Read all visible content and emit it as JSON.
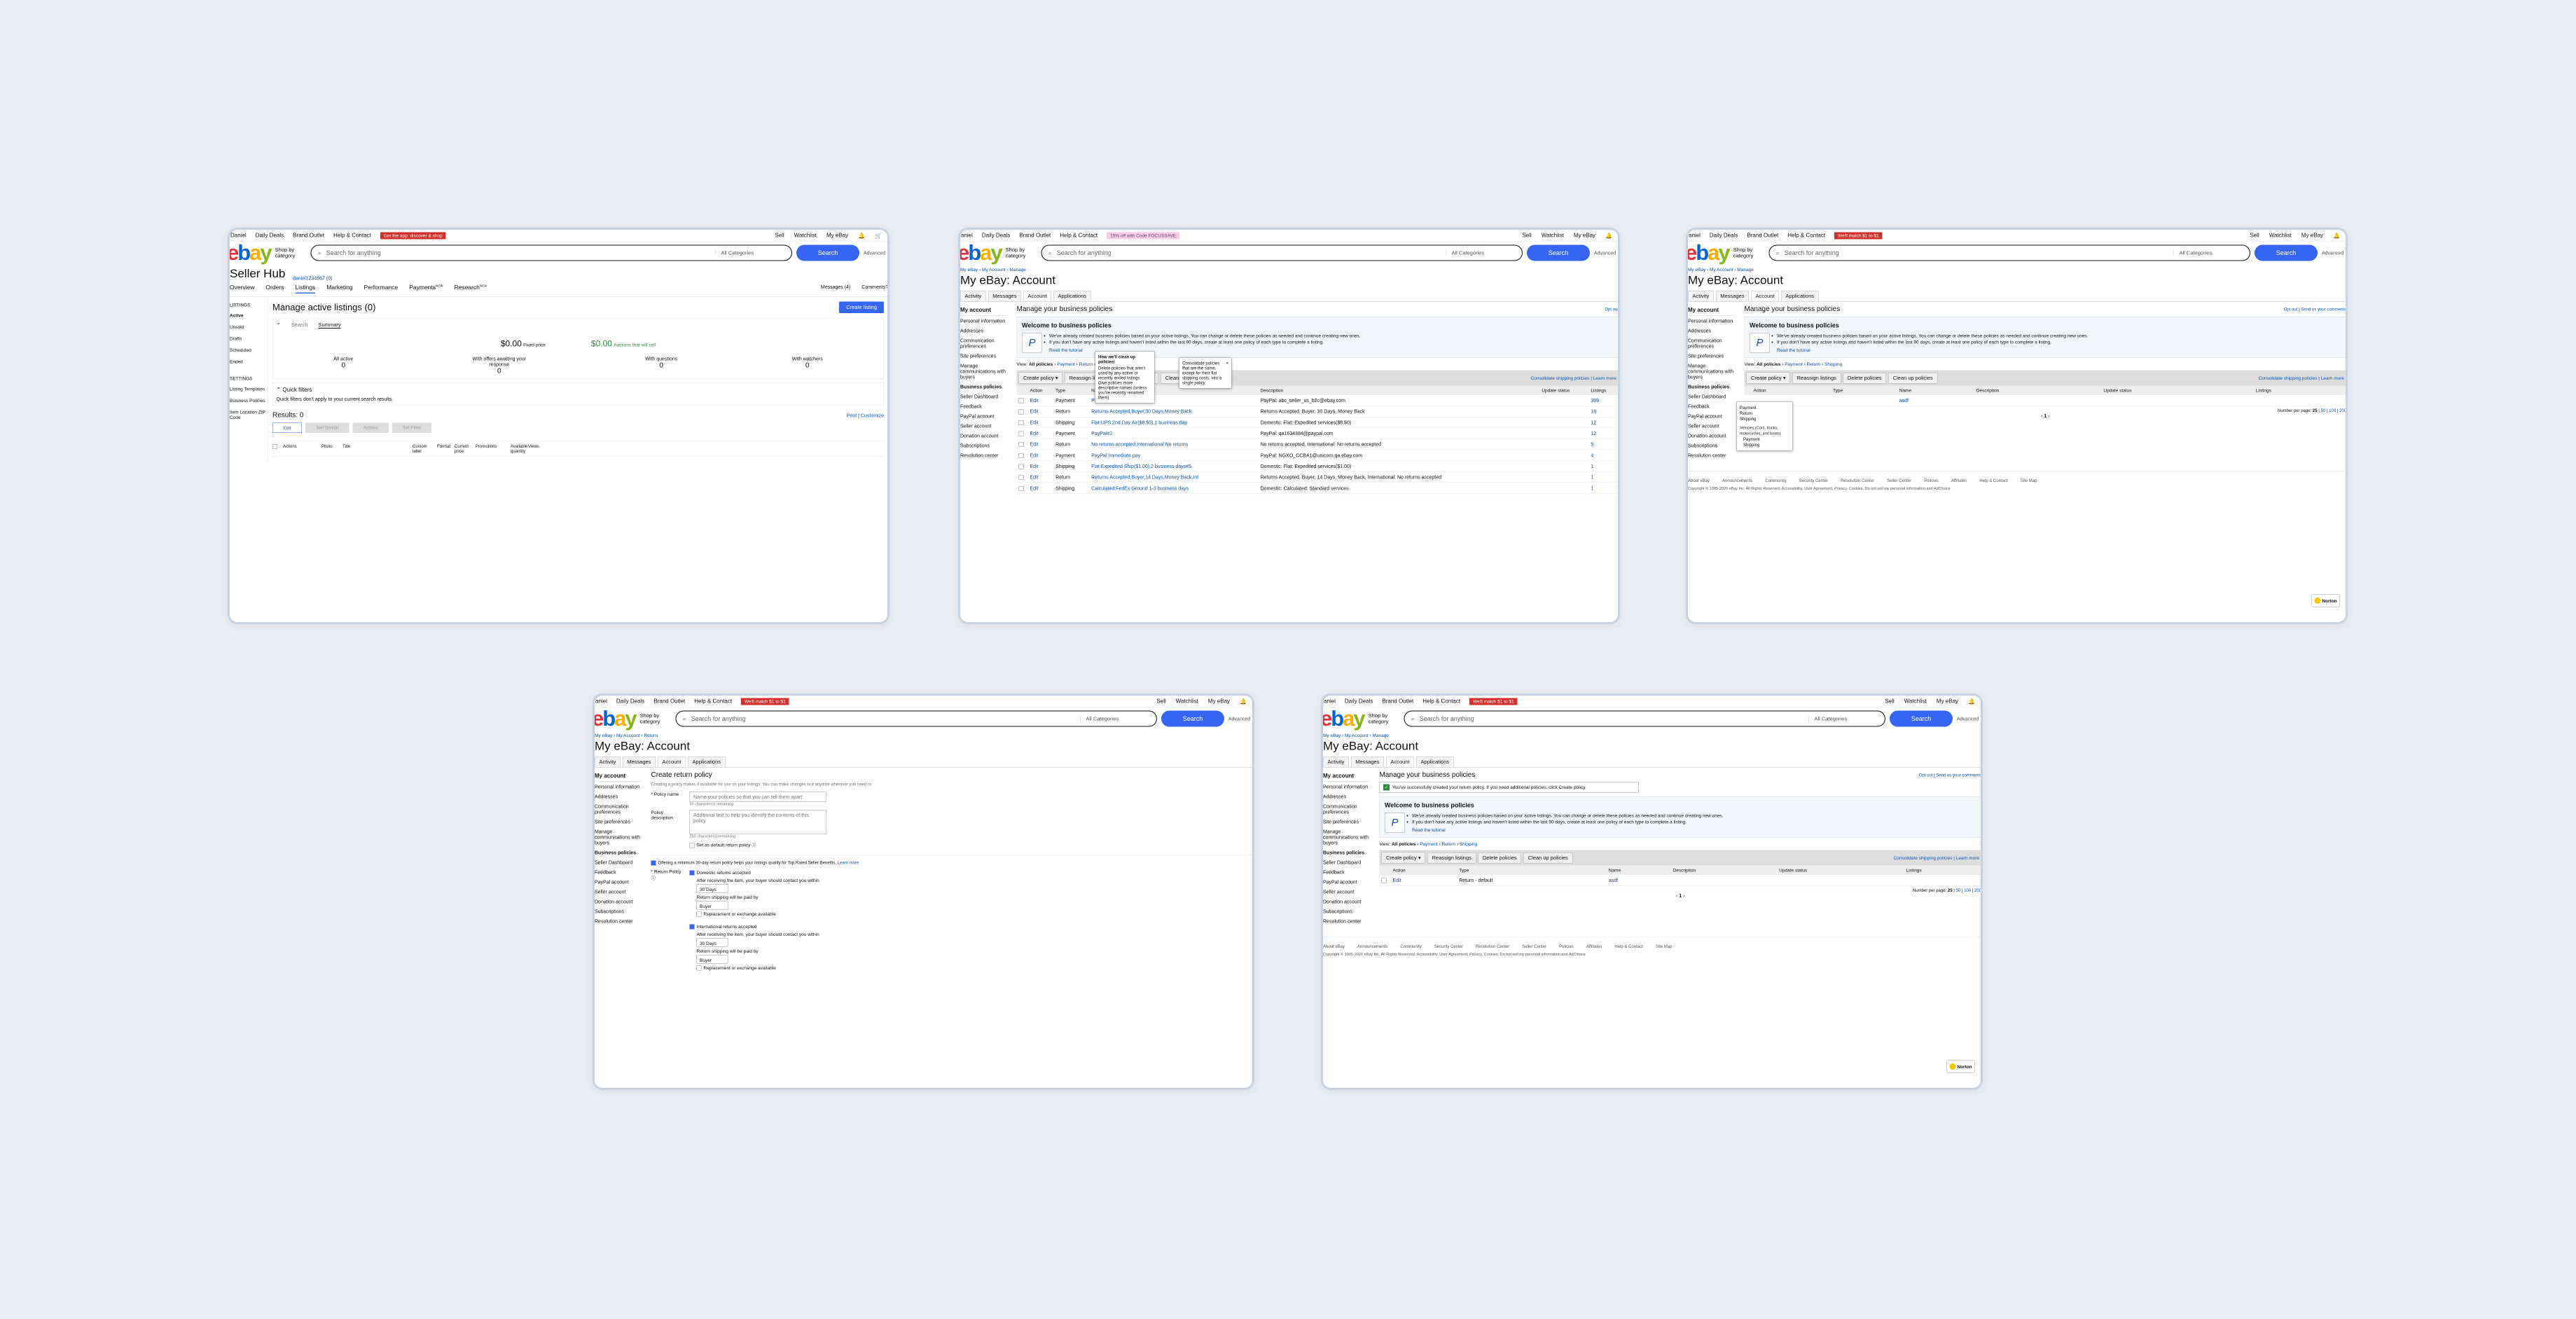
{
  "colors": {
    "accent": "#3665f3",
    "promo": "#d0312d",
    "background": "#eaeef3"
  },
  "header": {
    "user": "Daniel",
    "user_short": "aniel",
    "daily_deals": "Daily Deals",
    "brand_outlet": "Brand Outlet",
    "help": "Help & Contact",
    "promo1": "Get the app: discover & shop",
    "promo2": "15% off with Code FOCUSSAVE",
    "promo3": "We'll match $1 to $1",
    "sell": "Sell",
    "watchlist": "Watchlist",
    "myebay": "My eBay",
    "bell_icon": "bell-icon",
    "cart_icon": "cart-icon",
    "shop_by": "Shop by category",
    "search_placeholder": "Search for anything",
    "all_categories": "All Categories",
    "search_button": "Search",
    "advanced": "Advanced"
  },
  "p1": {
    "title": "Seller Hub",
    "username": "daniel1234567 (0)",
    "nav": [
      "Overview",
      "Orders",
      "Listings",
      "Marketing",
      "Performance",
      "Payments",
      "Research"
    ],
    "new_badge": "NEW",
    "messages": "Messages (4)",
    "comments": "Comments?",
    "sidebar_head": "LISTINGS",
    "sidebar": [
      "Active",
      "Unsold",
      "Drafts",
      "Scheduled",
      "Ended"
    ],
    "settings_head": "SETTINGS",
    "settings": [
      "Listing Templates",
      "Business Policies",
      "Item Location ZIP Code"
    ],
    "page_title": "Manage active listings (0)",
    "create_button": "Create listing",
    "tab_search": "Search",
    "tab_summary": "Summary",
    "fixed_amount": "$0.00",
    "fixed_label": "Fixed price",
    "auction_amount": "$0.00",
    "auction_label": "Auctions that will sell",
    "stats": [
      {
        "label": "All active",
        "value": "0"
      },
      {
        "label": "With offers awaiting your response",
        "value": "0"
      },
      {
        "label": "With questions",
        "value": "0"
      },
      {
        "label": "With watchers",
        "value": "0"
      }
    ],
    "quick_filters": "Quick filters",
    "quick_note": "Quick filters don't apply to your current search results.",
    "results": "Results: 0",
    "print": "Print",
    "customize": "Customize",
    "edit": "Edit",
    "buttons": [
      "Sell Similar",
      "Actions",
      "Set Filter"
    ],
    "columns": [
      "Actions",
      "Photo",
      "Title",
      "Custom label",
      "Format",
      "Current price",
      "Promotions",
      "Available quantity",
      "Views"
    ]
  },
  "account": {
    "breadcrumb": "My eBay › My Account › Manage",
    "breadcrumb_return": "My eBay › My Account › Return",
    "title": "My eBay: Account",
    "tabs": [
      "Activity",
      "Messages",
      "Account",
      "Applications"
    ],
    "side_head": "My account",
    "side": [
      "Personal information",
      "Addresses",
      "Communication preferences",
      "Site preferences",
      "Manage communications with buyers",
      "Business policies",
      "Seller Dashboard",
      "Feedback",
      "PayPal account",
      "Seller account",
      "Donation account",
      "Subscriptions",
      "Resolution center"
    ],
    "manage_title": "Manage your business policies",
    "opt_out": "Opt out",
    "send_comments": "Send us your comments",
    "welcome_title": "Welcome to business policies",
    "welcome_1": "We've already created business policies based on your active listings. You can change or delete these policies as needed and continue creating new ones.",
    "welcome_2": "If you don't have any active listings and haven't listed within the last 90 days, create at least one policy of each type to complete a listing.",
    "read_tutorial": "Read the tutorial",
    "view_label": "View:",
    "view_all": "All policies",
    "view_payment": "Payment",
    "view_return": "Return",
    "view_shipping": "Shipping",
    "toolbar": [
      "Create policy",
      "Reassign listings",
      "Delete policies",
      "Clean up policies"
    ],
    "consolidate": "Consolidate shipping policies",
    "learn_more": "Learn more",
    "columns": [
      "Action",
      "Type",
      "Name",
      "Description",
      "Update status",
      "Listings"
    ],
    "edit": "Edit",
    "per_page": "Number per page:",
    "per_page_options": [
      "25",
      "50",
      "100",
      "200"
    ],
    "page": "1",
    "cleanup_title": "How we'll clean up policies:",
    "cleanup_1": "Delete policies that aren't used by any active or recently ended listings",
    "cleanup_2": "Give policies more descriptive names (unless you've recently renamed them)",
    "consolidate_note": "Consolidate policies that are the same, except for their flat shipping costs, into a single policy.",
    "dropdown": [
      "Payment",
      "Return",
      "Shipping",
      "Vehicles (Cars, trucks, motorcycles, and boats)",
      "Payment",
      "Shipping"
    ],
    "success": "You've successfully created your return policy. If you need additional policies, click Create policy.",
    "single_row": {
      "type": "Return - default",
      "name": "asdf"
    }
  },
  "policies": [
    {
      "type": "Payment",
      "name": "PayPal#1",
      "desc": "PayPal: abc_seller_us_b2c@ebay.com",
      "listings": "399"
    },
    {
      "type": "Return",
      "name": "Returns Accepted,Buyer,30 Days,Money Back",
      "desc": "Returns Accepted, Buyer, 30 Days, Money Back",
      "listings": "16"
    },
    {
      "type": "Shipping",
      "name": "Flat:UPS 2nd Day Air($8.50),1 business day",
      "desc": "Domestic: Flat: Expedited services($8.50)",
      "listings": "12"
    },
    {
      "type": "Payment",
      "name": "PayPal#2",
      "desc": "PayPal: qa1634384@paypal.com",
      "listings": "12"
    },
    {
      "type": "Return",
      "name": "No returns accepted,International:No returns",
      "desc": "No returns accepted, International: No returns accepted",
      "listings": "5"
    },
    {
      "type": "Payment",
      "name": "PayPal:Immediate pay",
      "desc": "PayPal: NGXO_CCBA1@unicorn.qa.ebay.com",
      "listings": "4"
    },
    {
      "type": "Shipping",
      "name": "Flat:Expedited Ship($1.00),2 business days#5",
      "desc": "Domestic: Flat: Expedited services($1.00)",
      "listings": "1"
    },
    {
      "type": "Return",
      "name": "Returns Accepted,Buyer,14 Days,Money Back,Int",
      "desc": "Returns Accepted, Buyer, 14 Days, Money Back, International: No returns accepted",
      "listings": "1"
    },
    {
      "type": "Shipping",
      "name": "Calculated:FedEx Ground 1-3 business days",
      "desc": "Domestic: Calculated: Standard services",
      "listings": "1"
    }
  ],
  "return_form": {
    "title": "Create return policy",
    "intro": "Creating a policy makes it available for use on your listings. You can make changes to it anytime wherever you need to.",
    "name_label": "Policy name",
    "name_placeholder": "Name your policies so that you can tell them apart",
    "name_count": "50 character(s) remaining",
    "desc_label": "Policy description",
    "desc_placeholder": "Additional text to help you identify the contents of this policy",
    "desc_count": "250 character(s) remaining",
    "default_label": "Set as default return policy",
    "offer_note": "Offering a minimum 30-day return policy helps your listings qualify for Top Rated Seller Benefits.",
    "learn_more": "Learn more",
    "policy_label": "Return Policy",
    "domestic": "Domestic returns accepted",
    "within": "After receiving the item, your buyer should contact you within",
    "days": "30 Days",
    "paid_by": "Return shipping will be paid by",
    "buyer": "Buyer",
    "replacement": "Replacement or exchange available",
    "international": "International returns accepted"
  },
  "footer": {
    "links": [
      "About eBay",
      "Announcements",
      "Community",
      "Security Center",
      "Resolution Center",
      "Seller Center",
      "Policies",
      "Affiliates",
      "Help & Contact",
      "Site Map"
    ],
    "copyright": "Copyright © 1995-2020 eBay Inc. All Rights Reserved. Accessibility, User Agreement, Privacy, Cookies, Do not sell my personal information and AdChoice",
    "norton": "Norton"
  }
}
